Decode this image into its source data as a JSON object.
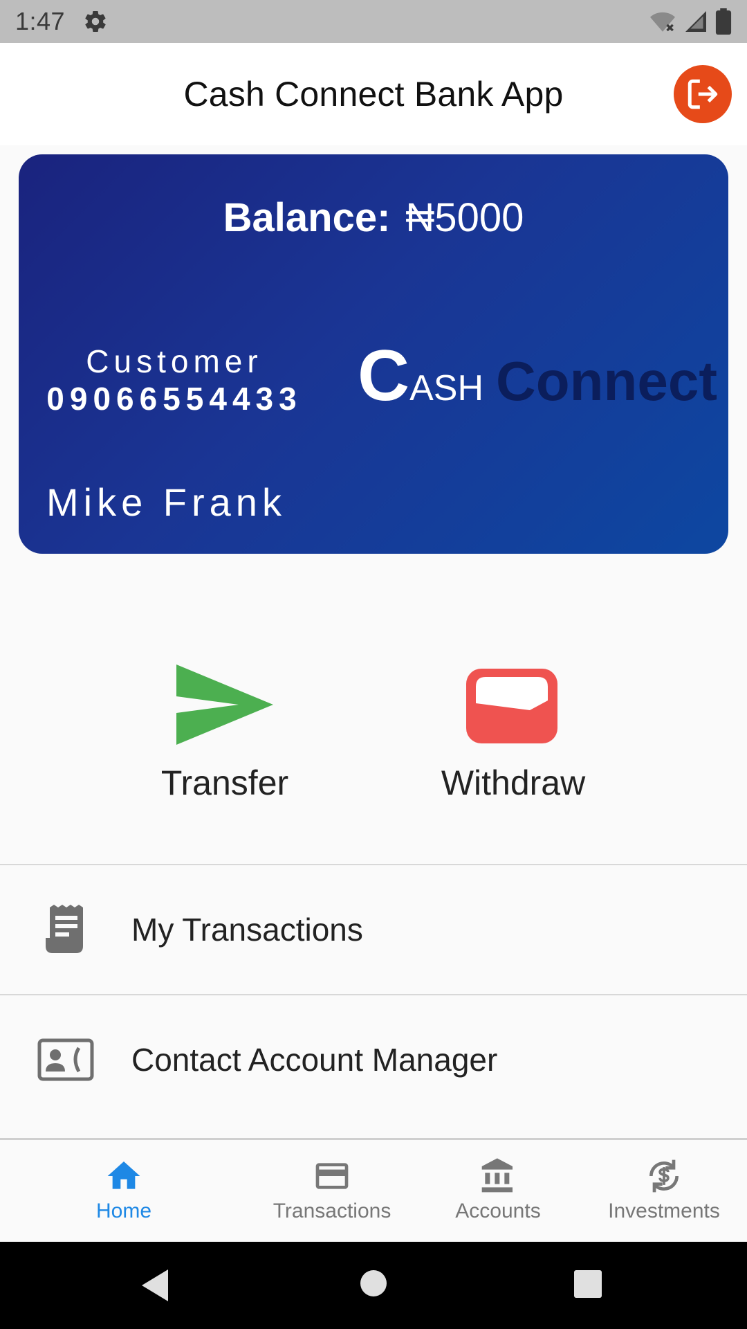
{
  "status_bar": {
    "time": "1:47"
  },
  "app_bar": {
    "title": "Cash Connect Bank App"
  },
  "card": {
    "balance_label": "Balance:",
    "balance_value": "₦5000",
    "customer_label": "Customer",
    "customer_number": "09066554433",
    "brand_c": "C",
    "brand_ash": "ASH",
    "brand_connect": "Connect",
    "cardholder": "Mike Frank"
  },
  "actions": {
    "transfer": "Transfer",
    "withdraw": "Withdraw"
  },
  "list": {
    "my_transactions": "My Transactions",
    "contact_manager": "Contact Account Manager"
  },
  "bottom_nav": {
    "items": [
      {
        "label": "Home",
        "icon": "home-icon",
        "active": true
      },
      {
        "label": "Transactions",
        "icon": "credit-card-icon",
        "active": false
      },
      {
        "label": "Accounts",
        "icon": "bank-icon",
        "active": false
      },
      {
        "label": "Investments",
        "icon": "currency-exchange-icon",
        "active": false
      }
    ]
  },
  "colors": {
    "accent": "#1e88e5",
    "logout": "#e64a19",
    "transfer": "#4caf50",
    "withdraw": "#ef5350",
    "card_start": "#1a237e",
    "card_end": "#0d47a1"
  }
}
